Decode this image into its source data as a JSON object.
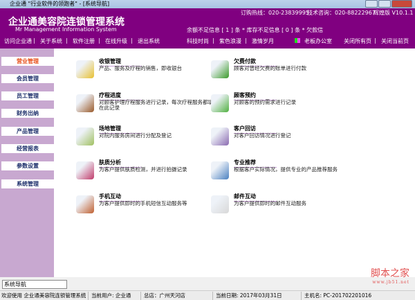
{
  "window": {
    "title": "企业通 \"行业软件的领跑者\" - [系统导航]"
  },
  "header": {
    "title": "企业通美容院连锁管理系统",
    "subtitle": "Mr Management Information System",
    "hotline": "订购热线：020-23839995",
    "support": "技术咨询：020-88222967",
    "version": "辉煌版 V10.1.1",
    "alerts": "余额不足信息 [ 1 ] 条  * 库存不足信息 [ 0 ] 条  * 欠款信",
    "nav_left": [
      "访问企业通",
      "关于系统",
      "软件注册",
      "在线升级",
      "退出系统"
    ],
    "themes": [
      "科技时尚",
      "紫色浪漫",
      "激情岁月"
    ],
    "office": "老板办公室",
    "close_all": "关闭所有页",
    "close_current": "关闭当前页",
    "sep": "|"
  },
  "sidebar": {
    "items": [
      {
        "label": "营业管理",
        "active": true
      },
      {
        "label": "会员管理"
      },
      {
        "label": "员工管理"
      },
      {
        "label": "财务出纳"
      },
      {
        "label": "产品管理"
      },
      {
        "label": "经营报表"
      },
      {
        "label": "参数设置"
      },
      {
        "label": "系统管理"
      }
    ]
  },
  "modules": [
    {
      "title": "收银管理",
      "desc": "产品、服务及疗程的销售，即收银台",
      "icon": "cash-register-icon",
      "color": "#e8c030"
    },
    {
      "title": "欠费付款",
      "desc": "顾客对曾经欠费的账单进行付款",
      "icon": "payment-arrow-icon",
      "color": "#3a9a2a"
    },
    {
      "title": "疗程进度",
      "desc": "对顾客护理疗程服务进行记录，每次疗程服务都填在此记录",
      "icon": "treatment-progress-icon",
      "color": "#9a5a2a"
    },
    {
      "title": "顾客预约",
      "desc": "对顾客的预约需求进行记录",
      "icon": "appointment-icon",
      "color": "#50b040"
    },
    {
      "title": "场地管理",
      "desc": "对院内服务房间进行分配及登记",
      "icon": "room-icon",
      "color": "#a0c060"
    },
    {
      "title": "客户回访",
      "desc": "对客户回访情况进行登记",
      "icon": "callback-icon",
      "color": "#8a6ab0"
    },
    {
      "title": "肤质分析",
      "desc": "为客户提供肤质检测，并进行拍摄记录",
      "icon": "skin-analysis-icon",
      "color": "#c03a6a"
    },
    {
      "title": "专业推荐",
      "desc": "根据客户实际情况，提供专业的产品推荐服务",
      "icon": "recommend-icon",
      "color": "#4a80c0"
    },
    {
      "title": "手机互动",
      "desc": "为客户提供即时的手机短信互动服务等",
      "icon": "mobile-users-icon",
      "color": "#c06030"
    },
    {
      "title": "邮件互动",
      "desc": "为客户提供即时的邮件互动服务",
      "icon": "mail-icon",
      "color": "#d8d8d8"
    }
  ],
  "navbox": {
    "value": "系统导航"
  },
  "status": {
    "welcome": "欢迎使用 企业通美容院连锁管理系统",
    "user": "当前用户: 企业通",
    "store": "总店：广州天河店",
    "date": "当前日期: 2017年03月31日",
    "host": "主机名: PC-201702201016"
  },
  "watermark": {
    "text": "脚本之家",
    "url": "www.jb51.net"
  }
}
